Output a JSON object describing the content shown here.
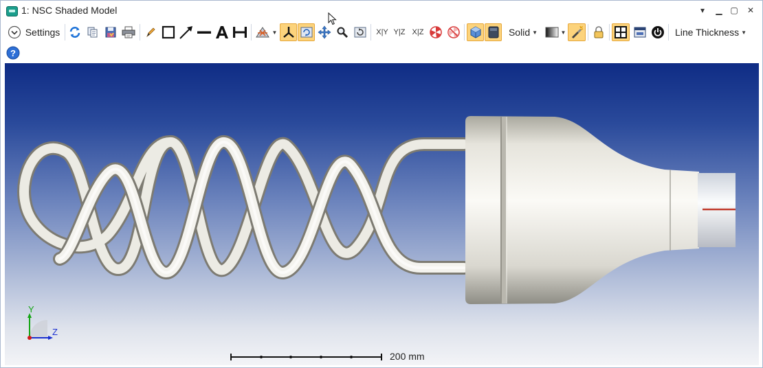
{
  "window": {
    "title": "1: NSC Shaded Model"
  },
  "title_controls": {
    "dropdown": "▾",
    "minimize": "▁",
    "maximize": "▢",
    "close": "✕"
  },
  "toolbar": {
    "settings_label": "Settings",
    "render_mode": "Solid",
    "line_thickness_label": "Line Thickness",
    "axis_views": {
      "xy": "X|Y",
      "yz": "Y|Z",
      "xz": "X|Z"
    },
    "help": "?"
  },
  "axes": {
    "y": "Y",
    "z": "Z",
    "x_color": "#d01a1a",
    "y_color": "#14a514",
    "z_color": "#1a2fd0"
  },
  "scale_bar": {
    "label": "200 mm"
  },
  "colors": {
    "accent_active": "#fcd37c",
    "viewport_top": "#0f2c85",
    "viewport_bottom": "#f3f4f7",
    "model": "#e8e6de",
    "detector_mark": "#c0392b"
  }
}
